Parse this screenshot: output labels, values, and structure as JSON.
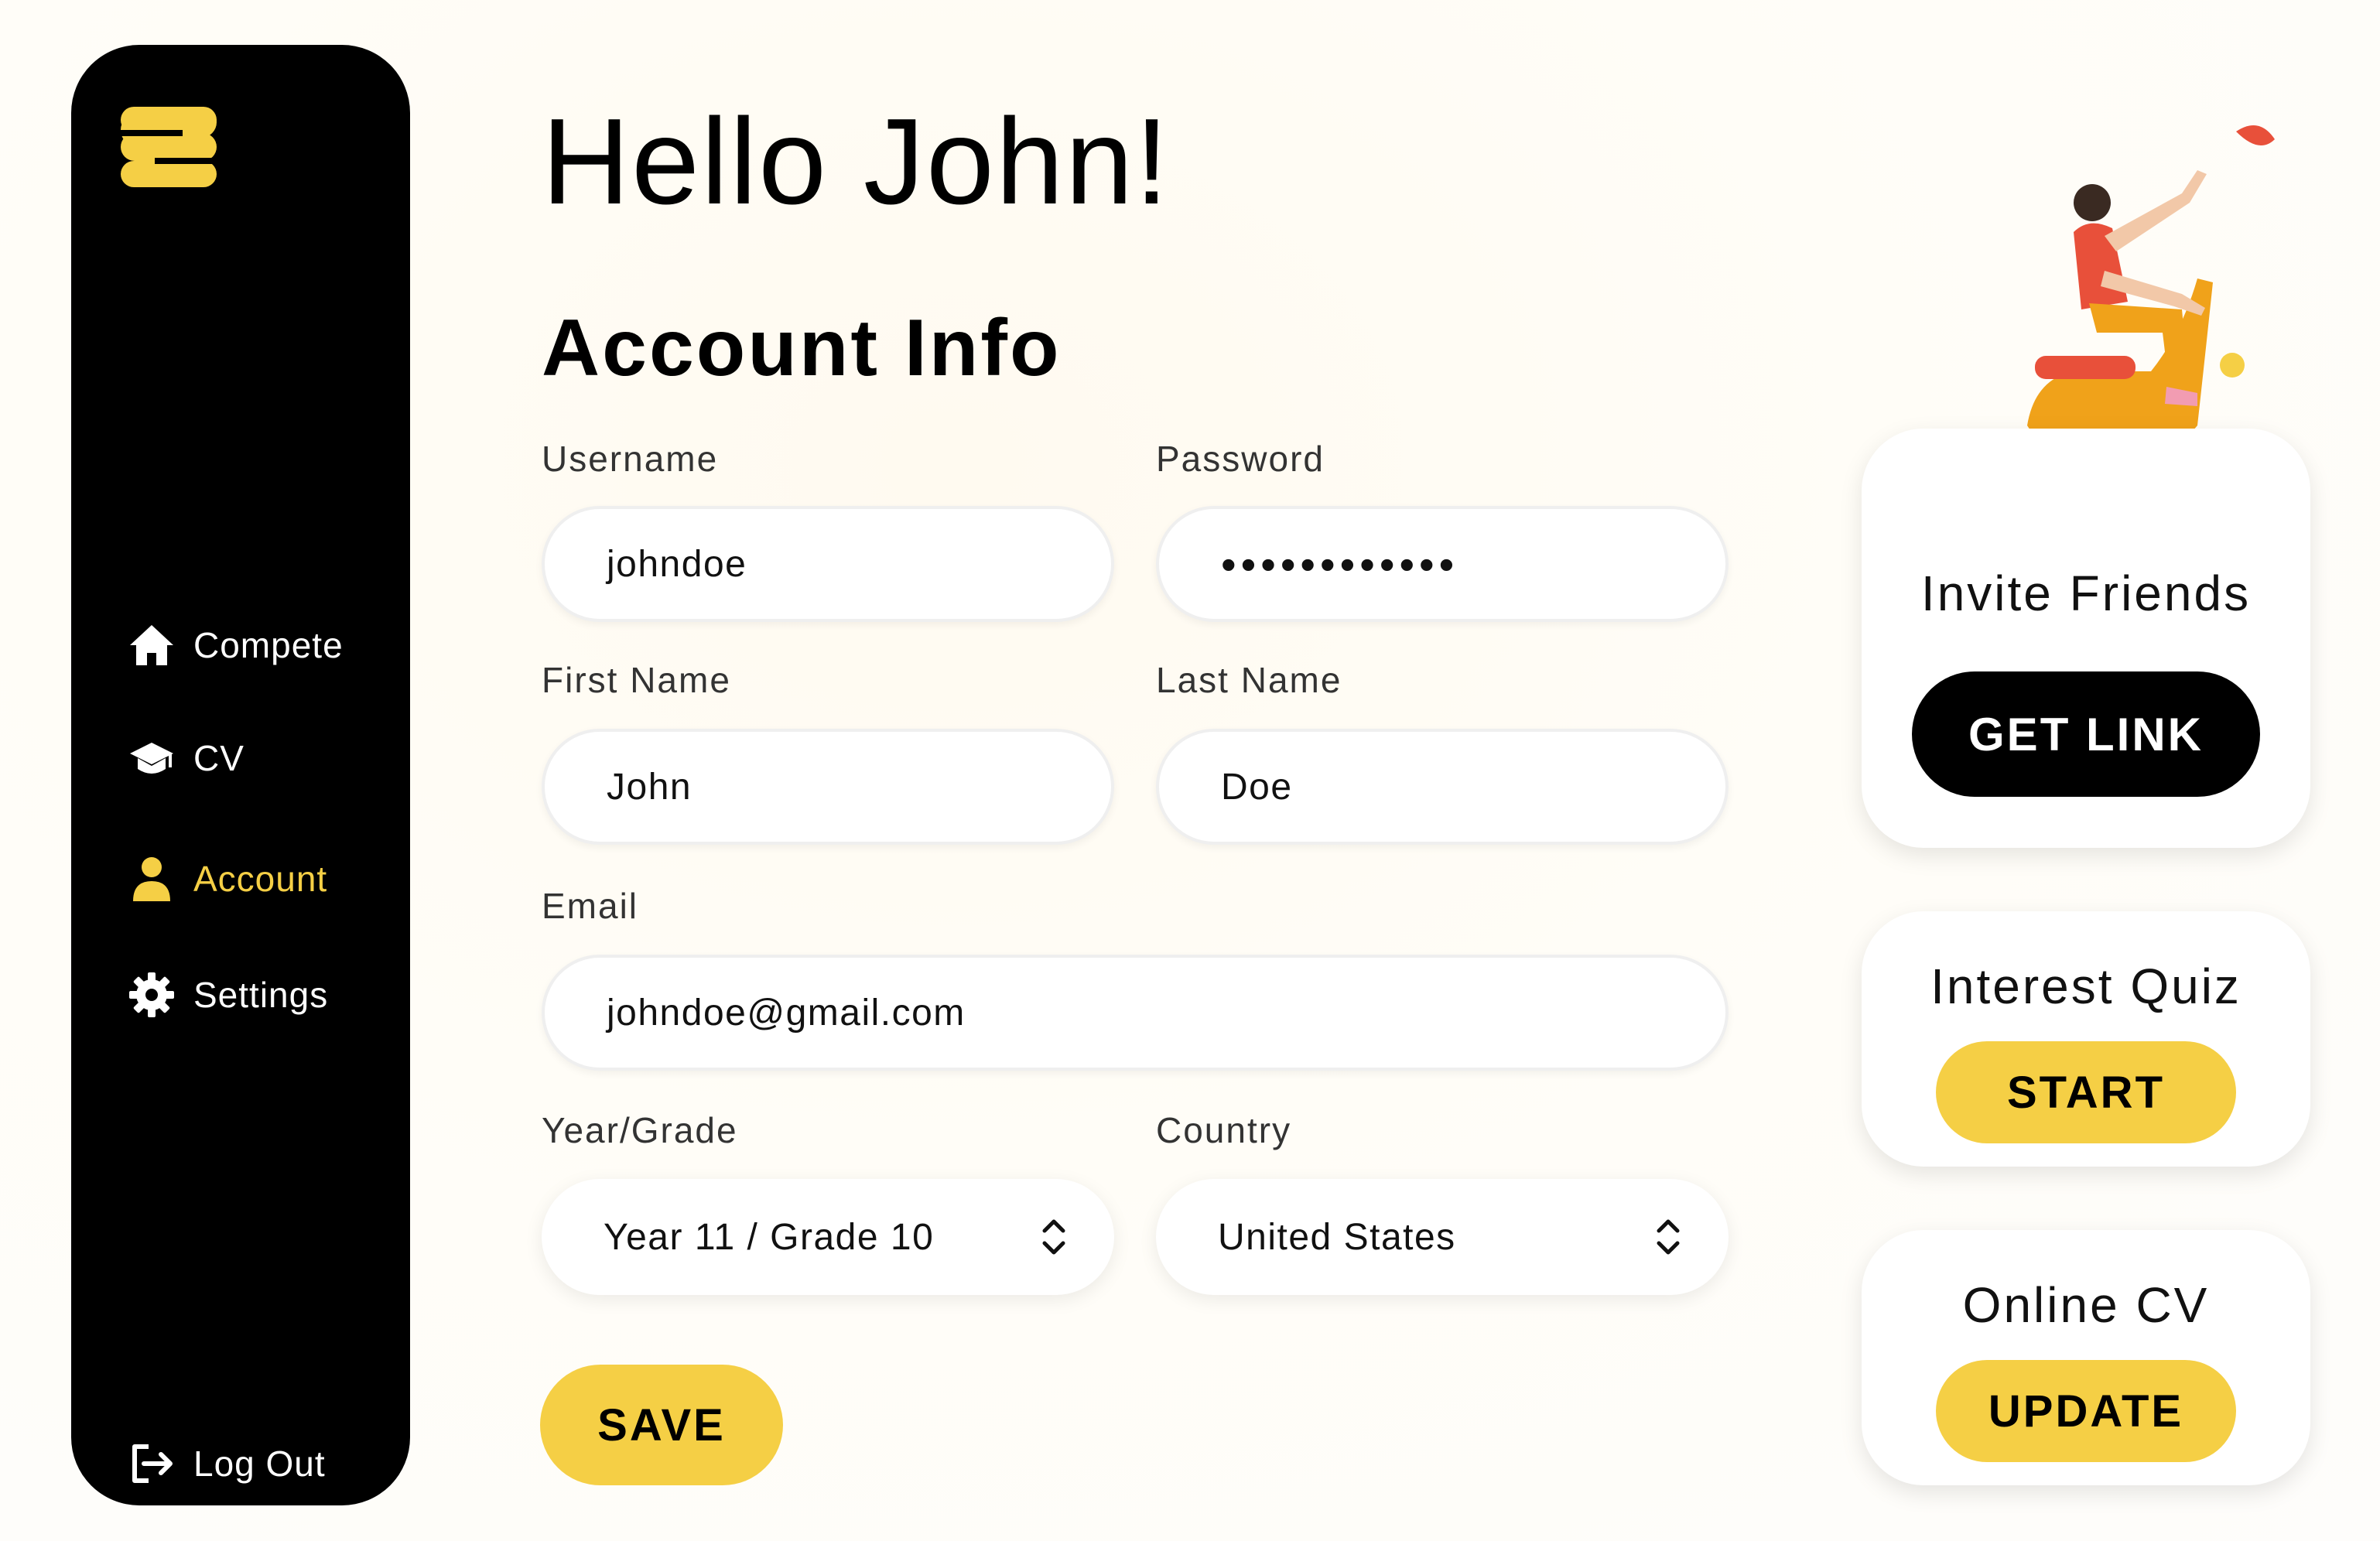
{
  "greeting": "Hello John!",
  "section_title": "Account Info",
  "sidebar": {
    "items": [
      {
        "label": "Compete",
        "icon": "home-icon",
        "active": false
      },
      {
        "label": "CV",
        "icon": "graduation-cap-icon",
        "active": false
      },
      {
        "label": "Account",
        "icon": "user-icon",
        "active": true
      },
      {
        "label": "Settings",
        "icon": "gear-icon",
        "active": false
      }
    ],
    "logout_label": "Log Out"
  },
  "form": {
    "username_label": "Username",
    "username_value": "johndoe",
    "password_label": "Password",
    "password_value": "••••••••••••",
    "first_name_label": "First Name",
    "first_name_value": "John",
    "last_name_label": "Last Name",
    "last_name_value": "Doe",
    "email_label": "Email",
    "email_value": "johndoe@gmail.com",
    "year_label": "Year/Grade",
    "year_value": "Year 11 / Grade 10",
    "country_label": "Country",
    "country_value": "United States",
    "save_label": "SAVE"
  },
  "cards": {
    "invite": {
      "title": "Invite Friends",
      "button": "GET LINK"
    },
    "quiz": {
      "title": "Interest Quiz",
      "button": "START"
    },
    "online_cv": {
      "title": "Online CV",
      "button": "UPDATE"
    }
  },
  "colors": {
    "accent": "#f5cf45",
    "sidebar_bg": "#000000",
    "background": "#fffcf5"
  }
}
